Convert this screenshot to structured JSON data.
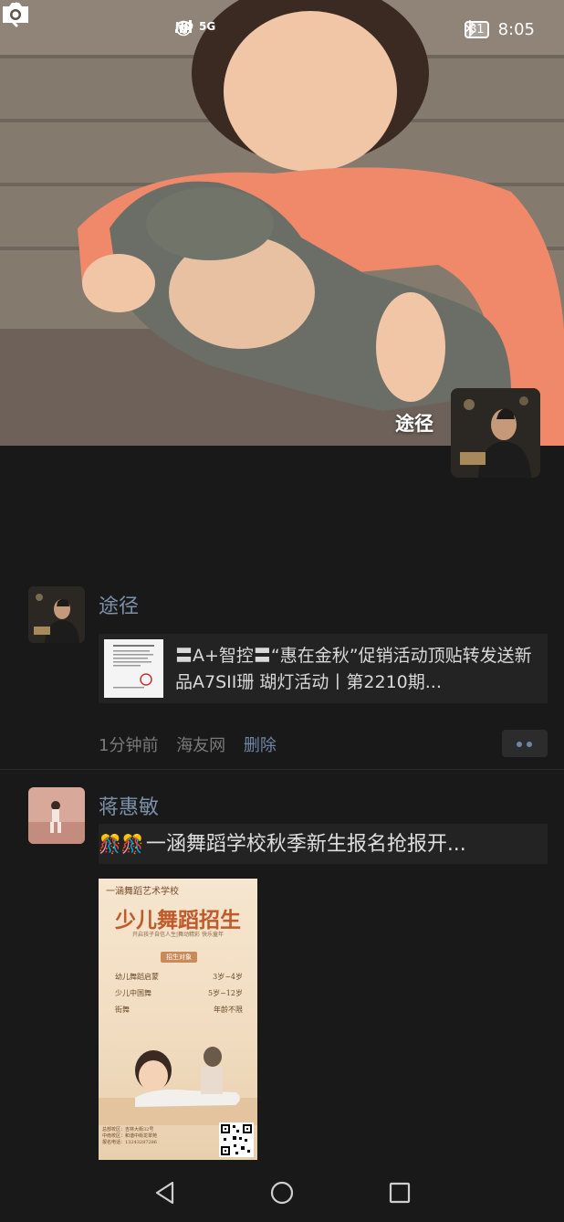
{
  "status_bar": {
    "network_left": "HD",
    "network_gen": "5G",
    "battery": "81",
    "time": "8:05"
  },
  "cover": {
    "username": "途径",
    "back_icon": "back-chevron-icon",
    "camera_icon": "camera-icon"
  },
  "posts": [
    {
      "name": "途径",
      "link_title": "〓A+智控〓“惠在金秋”促销活动顶贴转发送新品A7SII珊 瑚灯活动丨第2210期...",
      "time": "1分钟前",
      "source": "海友网",
      "delete_label": "删除"
    },
    {
      "name": "蒋惠敏",
      "emoji": "🎊🎊",
      "text": "一涵舞蹈学校秋季新生报名抢报开...",
      "poster": {
        "school": "一涵舞蹈艺术学校",
        "headline": "少儿舞蹈招生",
        "slogan": "开启孩子自信人生|舞动精彩 快乐童年",
        "target_label": "招生对象",
        "rows": [
          {
            "course": "幼儿舞蹈启蒙",
            "age": "3岁~4岁"
          },
          {
            "course": "少儿中国舞",
            "age": "5岁~12岁"
          },
          {
            "course": "街舞",
            "age": "年龄不限"
          }
        ],
        "contact": [
          "总部校区：吉林大街32号",
          "中南校区：和谐中街龙翠苑",
          "报名电话：13243287286"
        ]
      }
    }
  ],
  "nav": {
    "back": "nav-back-icon",
    "home": "nav-home-icon",
    "recents": "nav-recents-icon"
  }
}
